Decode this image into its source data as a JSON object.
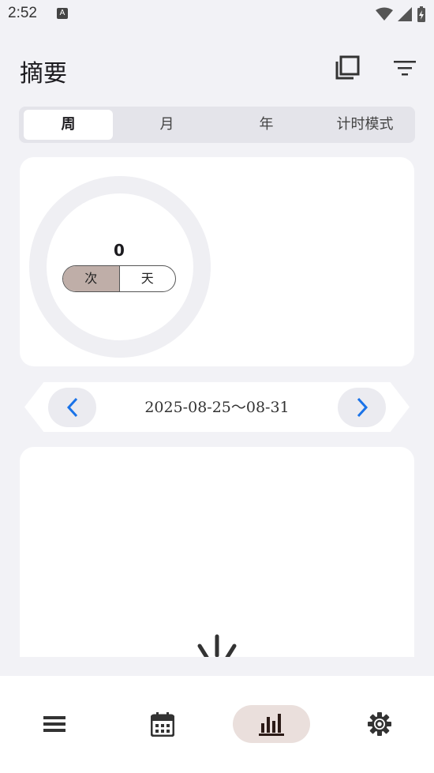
{
  "status_bar": {
    "time": "2:52",
    "notification_icon": "A"
  },
  "header": {
    "title": "摘要",
    "actions": [
      "copy-icon",
      "filter-icon"
    ]
  },
  "segments": [
    {
      "label": "周",
      "active": true
    },
    {
      "label": "月",
      "active": false
    },
    {
      "label": "年",
      "active": false
    },
    {
      "label": "计时模式",
      "active": false
    }
  ],
  "summary_card": {
    "value": "0",
    "unit_toggle": [
      {
        "label": "次",
        "selected": true
      },
      {
        "label": "天",
        "selected": false
      }
    ]
  },
  "date_range": {
    "label": "2025-08-25～08-31"
  },
  "bottom_nav": [
    {
      "icon": "list-icon",
      "active": false
    },
    {
      "icon": "calendar-icon",
      "active": false
    },
    {
      "icon": "bar-chart-icon",
      "active": true
    },
    {
      "icon": "settings-icon",
      "active": false
    }
  ],
  "colors": {
    "accent": "#1a73e8",
    "selected_toggle": "#bfaea8",
    "active_nav": "#eadfdc"
  }
}
